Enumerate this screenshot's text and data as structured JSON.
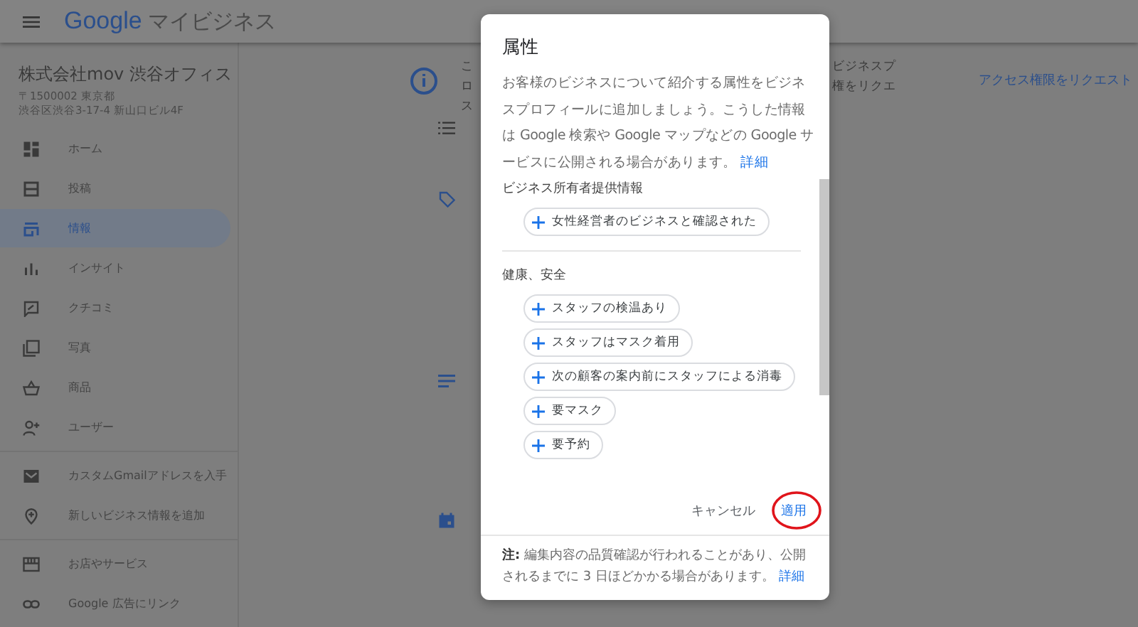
{
  "top_bar": {
    "brand": "Google",
    "product": "マイビジネス"
  },
  "sidebar": {
    "business_name": "株式会社mov 渋谷オフィス",
    "address_lines": [
      "〒1500002 東京都",
      "渋谷区渋谷3-17-4 新山口ビル4F"
    ],
    "items": [
      {
        "label": "ホーム",
        "selected": false
      },
      {
        "label": "投稿",
        "selected": false
      },
      {
        "label": "情報",
        "selected": true
      },
      {
        "label": "インサイト",
        "selected": false
      },
      {
        "label": "クチコミ",
        "selected": false
      },
      {
        "label": "写真",
        "selected": false
      },
      {
        "label": "商品",
        "selected": false
      },
      {
        "label": "ユーザー",
        "selected": false
      }
    ],
    "extra_items": [
      "カスタムGmailアドレスを入手",
      "新しいビジネス情報を追加"
    ],
    "bottom_items": [
      "お店やサービス",
      "Google 広告にリンク"
    ]
  },
  "banner": {
    "left_fragments": [
      "こ",
      "ロ",
      "ス"
    ],
    "right_fragments": [
      "ビジネスプ",
      "権をリクエ"
    ],
    "link": "アクセス権限をリクエスト"
  },
  "dialog": {
    "title": "属性",
    "description": "お客様のビジネスについて紹介する属性をビジネスプロフィールに追加しましょう。こうした情報は Google 検索や Google マップなどの Google サービスに公開される場合があります。",
    "description_link": "詳細",
    "sections": [
      {
        "heading": "ビジネス所有者提供情報",
        "chips": [
          "女性経営者のビジネスと確認された"
        ]
      },
      {
        "heading": "健康、安全",
        "chips": [
          "スタッフの検温あり",
          "スタッフはマスク着用",
          "次の顧客の案内前にスタッフによる消毒",
          "要マスク",
          "要予約"
        ]
      }
    ],
    "cancel": "キャンセル",
    "apply": "適用",
    "note": "**注:** 編集内容の品質確認が行われることがあり、公開されるまでに 3 日ほどかかる場合があります。",
    "note_link": "詳細"
  }
}
